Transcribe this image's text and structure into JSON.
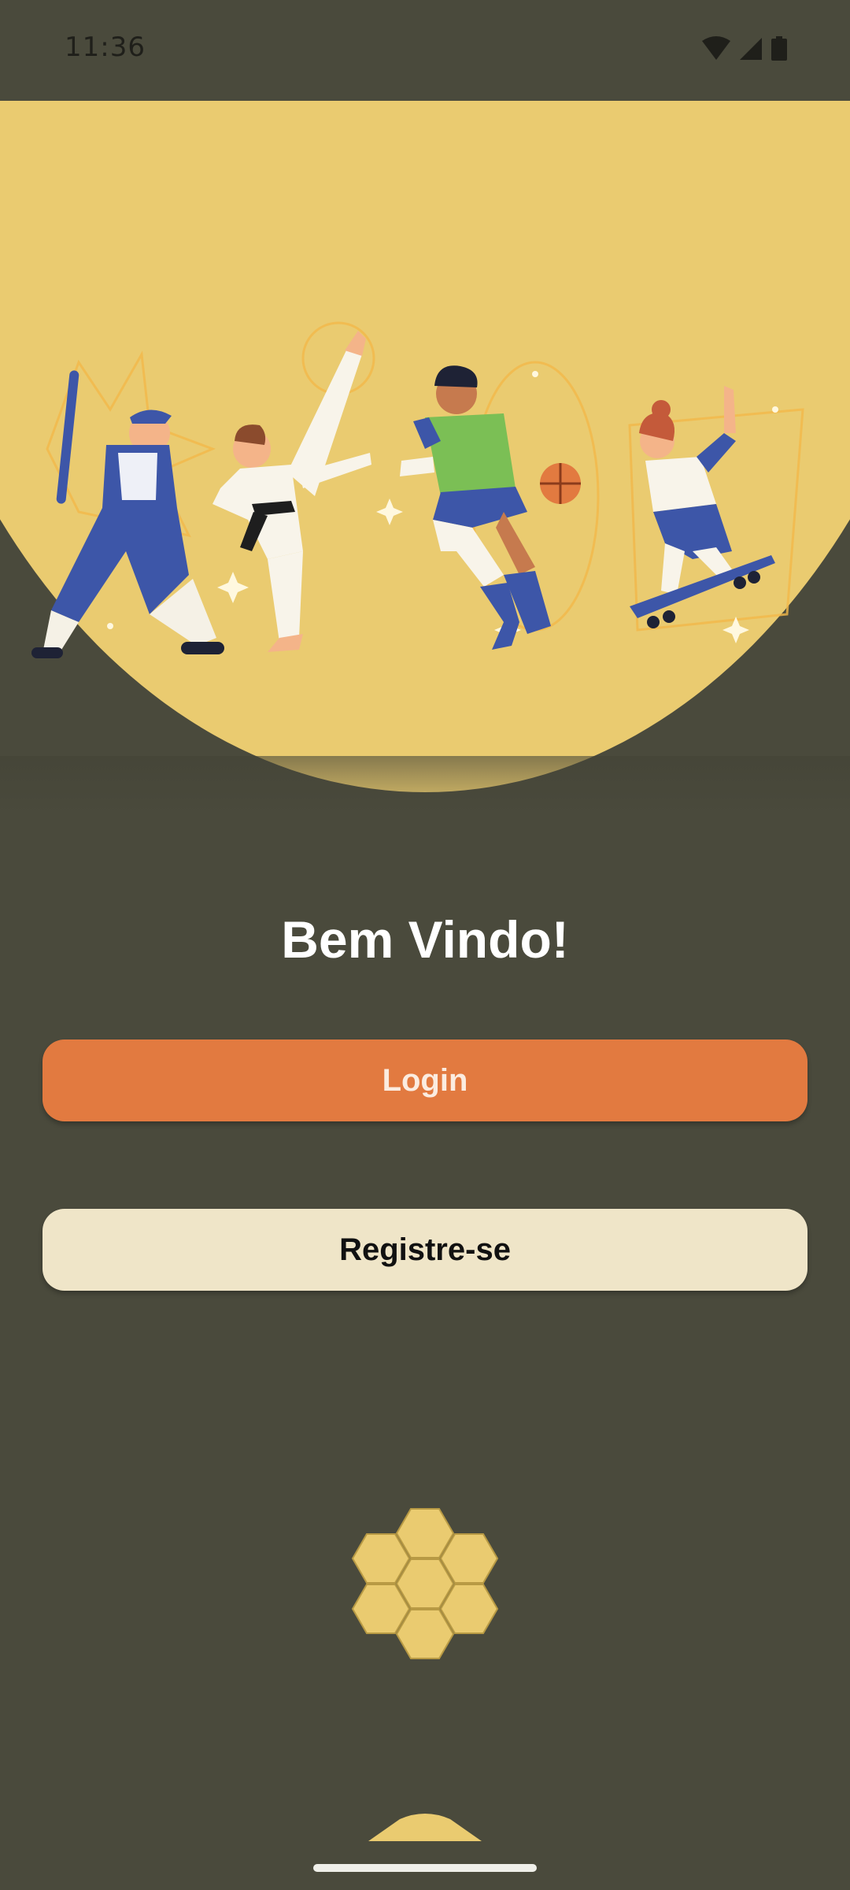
{
  "status_bar": {
    "time": "11:36",
    "icons": [
      "wifi-icon",
      "cell-signal-icon",
      "battery-icon"
    ]
  },
  "hero": {
    "illustration": "sports-players-illustration",
    "figures": [
      "baseball-player",
      "karate-fighter",
      "basketball-player",
      "skateboarder"
    ]
  },
  "welcome": {
    "title": "Bem Vindo!"
  },
  "buttons": {
    "login_label": "Login",
    "register_label": "Registre-se"
  },
  "logo": "honeycomb-logo-icon",
  "colors": {
    "background": "#4a4a3c",
    "hero": "#eacb70",
    "login_button": "#e27a40",
    "register_button": "#efe5c8"
  }
}
